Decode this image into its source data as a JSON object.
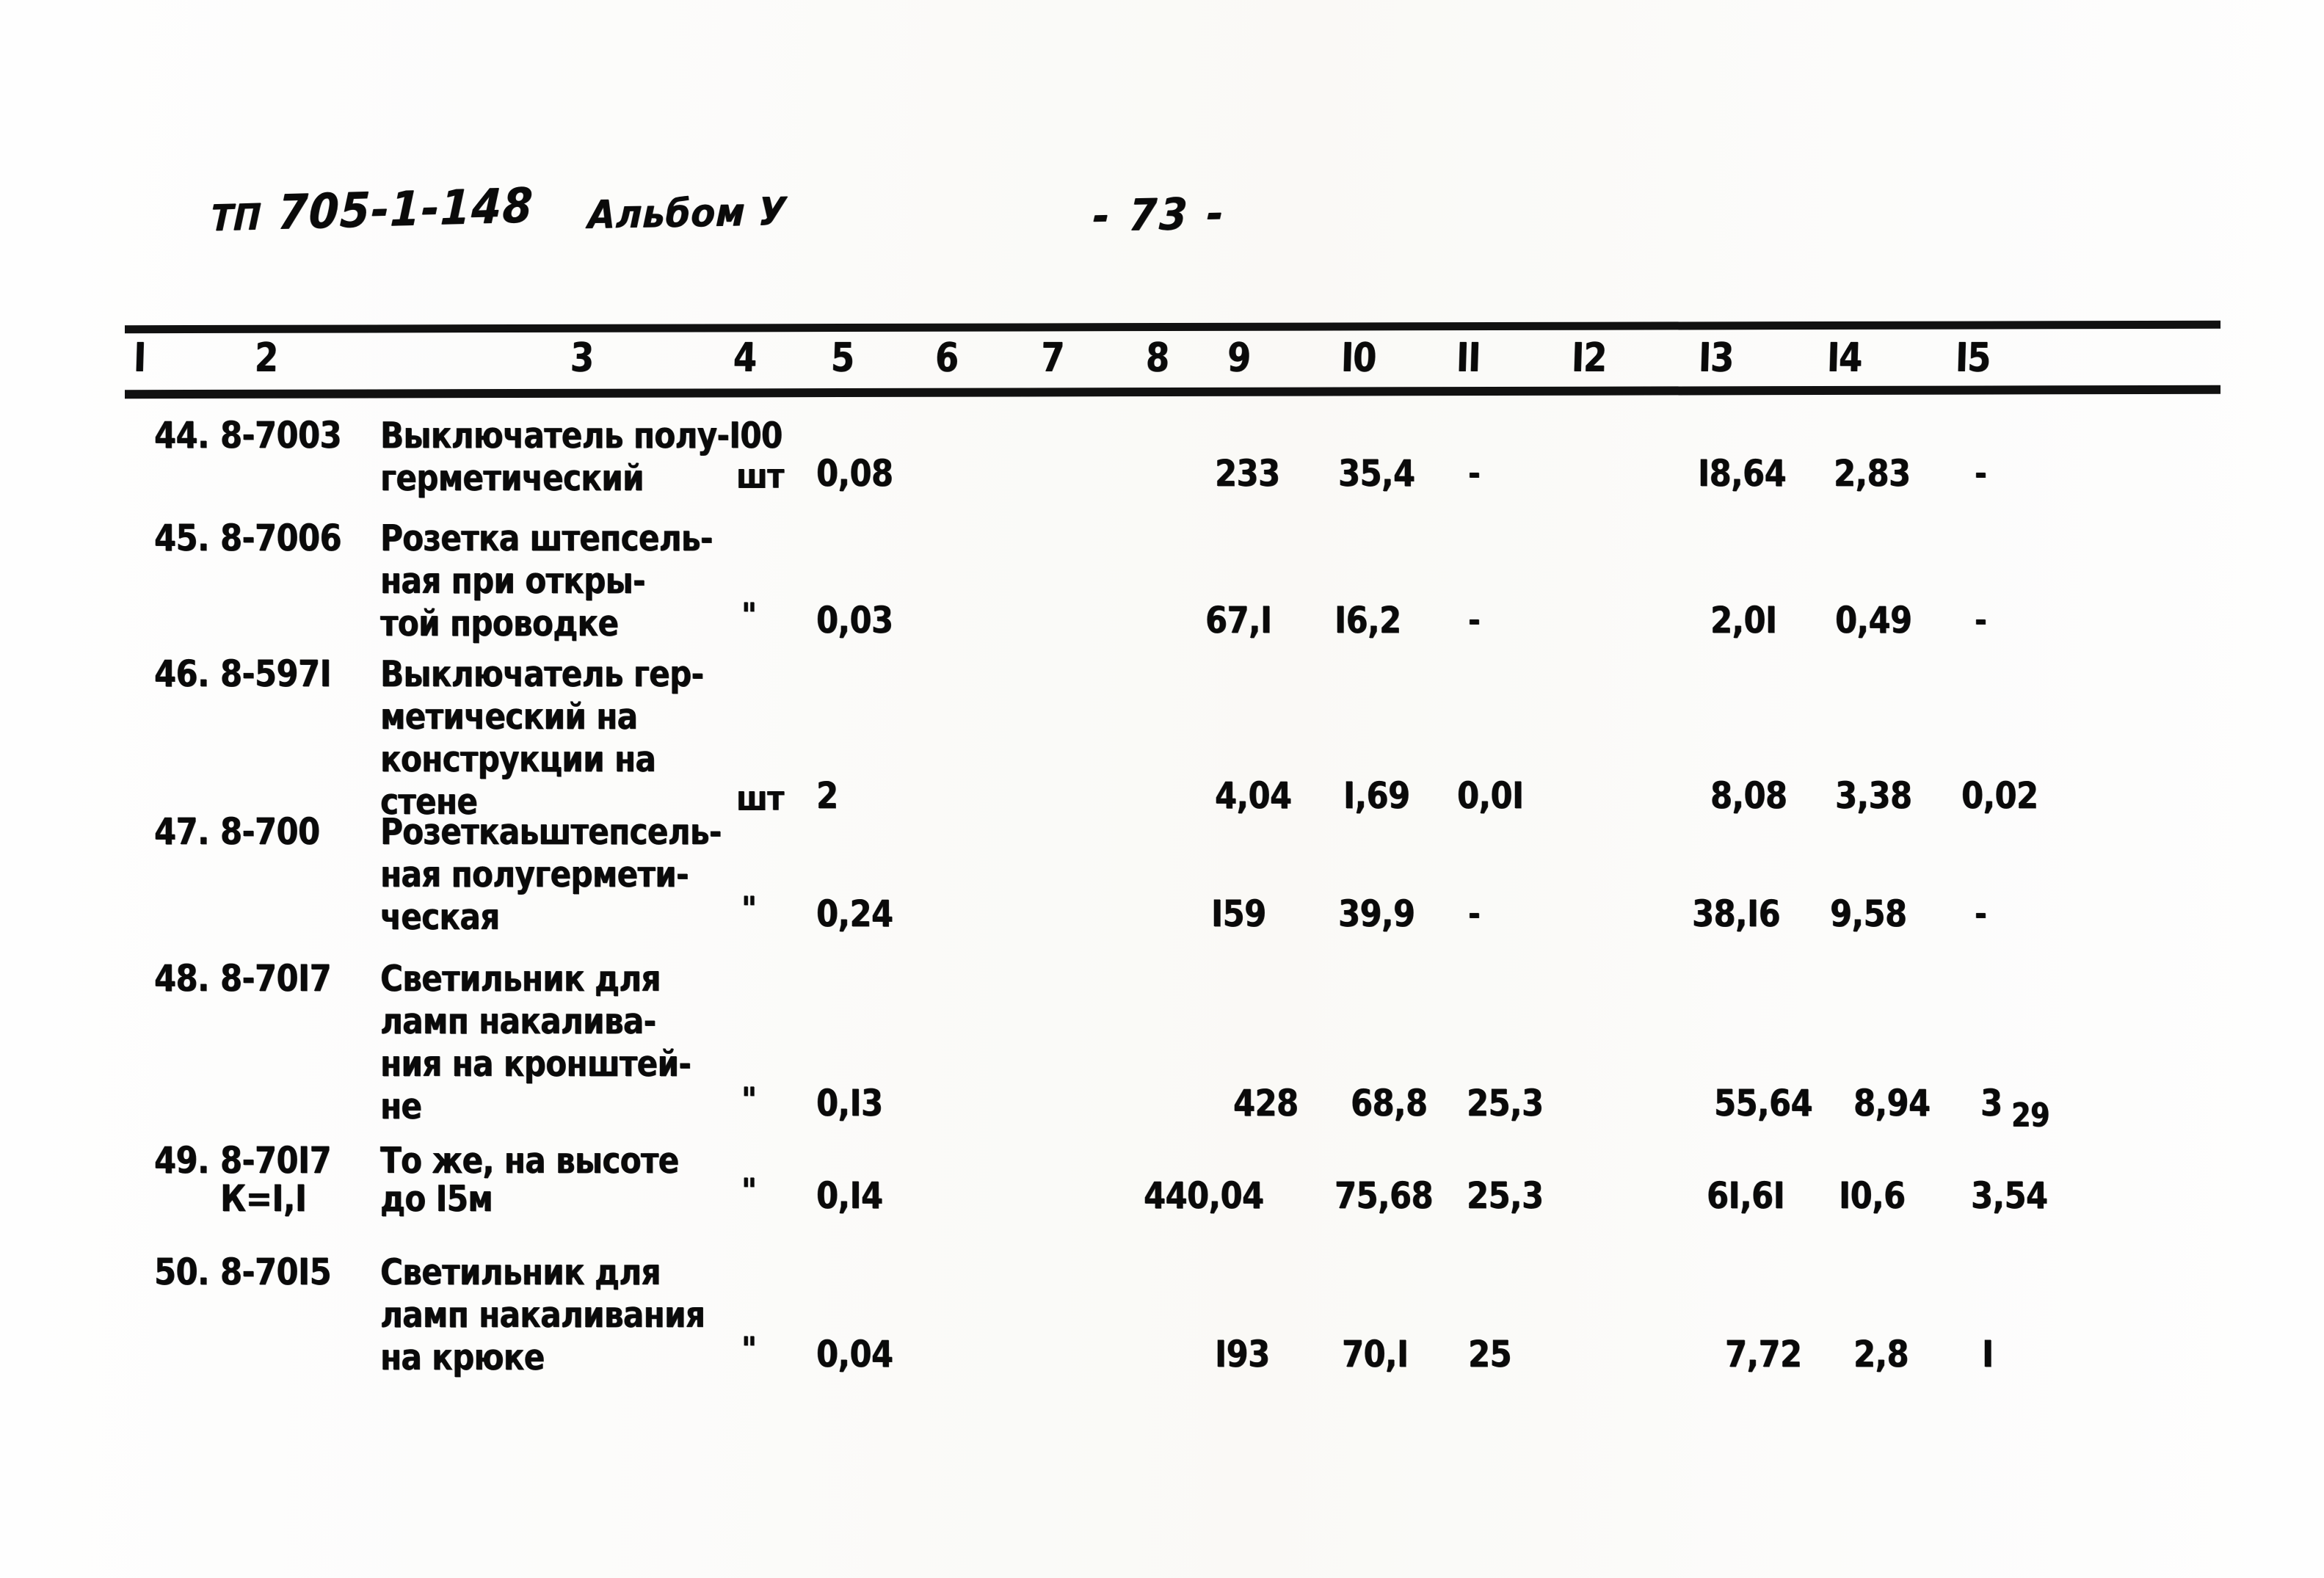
{
  "document": {
    "header_prefix": "ТП",
    "header_code": "705-1-148",
    "album_label": "Альбом У",
    "page_number": "- 73 -"
  },
  "table": {
    "column_numbers": [
      "I",
      "2",
      "3",
      "4",
      "5",
      "6",
      "7",
      "8",
      "9",
      "I0",
      "II",
      "I2",
      "I3",
      "I4",
      "I5"
    ],
    "rows": [
      {
        "no": "44.",
        "code": "8-7003",
        "name_lines": [
          "Выключатель полу-I00",
          "герметический"
        ],
        "unit": "шт",
        "col5": "0,08",
        "col9": "233",
        "col10": "35,4",
        "col11": "-",
        "col13": "I8,64",
        "col14": "2,83",
        "col15": "-"
      },
      {
        "no": "45.",
        "code": "8-7006",
        "name_lines": [
          "Розетка штепсель-",
          "ная при откры-",
          "той проводке"
        ],
        "unit": "\"",
        "col5": "0,03",
        "col9": "67,I",
        "col10": "I6,2",
        "col11": "-",
        "col13": "2,0I",
        "col14": "0,49",
        "col15": "-"
      },
      {
        "no": "46.",
        "code": "8-597I",
        "name_lines": [
          "Выключатель гер-",
          "метический на",
          "конструкции на",
          "стене"
        ],
        "unit": "шт",
        "col5": "2",
        "col9": "4,04",
        "col10": "I,69",
        "col11": "0,0I",
        "col13": "8,08",
        "col14": "3,38",
        "col15": "0,02"
      },
      {
        "no": "47.",
        "code": "8-700",
        "name_lines": [
          "Розеткаьштепсель-",
          "ная полугермети-",
          "ческая"
        ],
        "unit": "\"",
        "col5": "0,24",
        "col9": "I59",
        "col10": "39,9",
        "col11": "-",
        "col13": "38,I6",
        "col14": "9,58",
        "col15": "-"
      },
      {
        "no": "48.",
        "code": "8-70I7",
        "name_lines": [
          "Светильник для",
          "ламп накалива-",
          "ния на кронштей-",
          "не"
        ],
        "unit": "\"",
        "col5": "0,I3",
        "col9": "428",
        "col10": "68,8",
        "col11": "25,3",
        "col13": "55,64",
        "col14": "8,94",
        "col15": "3",
        "col15_tail": "29"
      },
      {
        "no": "49.",
        "code": "8-70I7",
        "code_line2": "К=I,I",
        "name_lines": [
          "То же, на высоте",
          "до I5м"
        ],
        "unit": "\"",
        "col5": "0,I4",
        "col9": "440,04",
        "col10": "75,68",
        "col11": "25,3",
        "col13": "6I,6I",
        "col14": "I0,6",
        "col15": "3,54"
      },
      {
        "no": "50.",
        "code": "8-70I5",
        "name_lines": [
          "Светильник для",
          "ламп накаливания",
          "на крюке"
        ],
        "unit": "\"",
        "col5": "0,04",
        "col9": "I93",
        "col10": "70,I",
        "col11": "25",
        "col13": "7,72",
        "col14": "2,8",
        "col15": "I"
      }
    ]
  }
}
